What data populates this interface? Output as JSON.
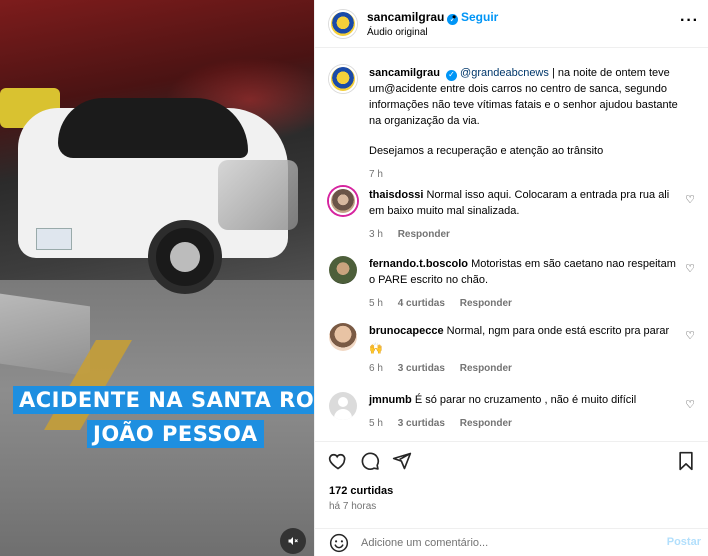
{
  "media": {
    "caption_line1": "ACIDENTE NA SANTA ROSA COM A",
    "caption_line2": "JOÃO PESSOA",
    "mute_icon": "speaker-muted-icon"
  },
  "header": {
    "username": "sancamilgrau",
    "dot": "•",
    "follow_label": "Seguir",
    "audio_label": "Áudio original",
    "more_icon": "more-horizontal-icon"
  },
  "caption": {
    "username": "sancamilgrau",
    "mention": "@grandeabcnews",
    "text": " | na noite de ontem teve um@acidente entre dois carros no centro de sanca, segundo informações não teve vítimas fatais e o senhor ajudou bastante na organização da via.",
    "text2": "Desejamos a recuperação e atenção ao trânsito",
    "time": "7 h"
  },
  "comments": [
    {
      "username": "thaisdossi",
      "text": "Normal isso aqui. Colocaram a entrada pra rua ali em baixo muito mal sinalizada.",
      "time": "3 h",
      "likes": "",
      "reply": "Responder"
    },
    {
      "username": "fernando.t.boscolo",
      "text": "Motoristas em são caetano nao respeitam o PARE escrito no chão.",
      "time": "5 h",
      "likes": "4 curtidas",
      "reply": "Responder"
    },
    {
      "username": "brunocapecce",
      "text": "Normal, ngm para onde está escrito pra parar",
      "emoji": "🙌",
      "time": "6 h",
      "likes": "3 curtidas",
      "reply": "Responder"
    },
    {
      "username": "jmnumb",
      "text": "É só parar no cruzamento , não é muito difícil",
      "time": "5 h",
      "likes": "3 curtidas",
      "reply": "Responder"
    }
  ],
  "actions": {
    "like_icon": "heart-icon",
    "comment_icon": "comment-icon",
    "share_icon": "share-icon",
    "save_icon": "bookmark-icon",
    "likes_count": "172 curtidas",
    "posted_ago": "há 7 horas"
  },
  "add_comment": {
    "placeholder": "Adicione um comentário...",
    "post_label": "Postar",
    "emoji_icon": "emoji-icon"
  },
  "colors": {
    "accent": "#0095f6",
    "caption_bg": "#1e8fe0"
  }
}
